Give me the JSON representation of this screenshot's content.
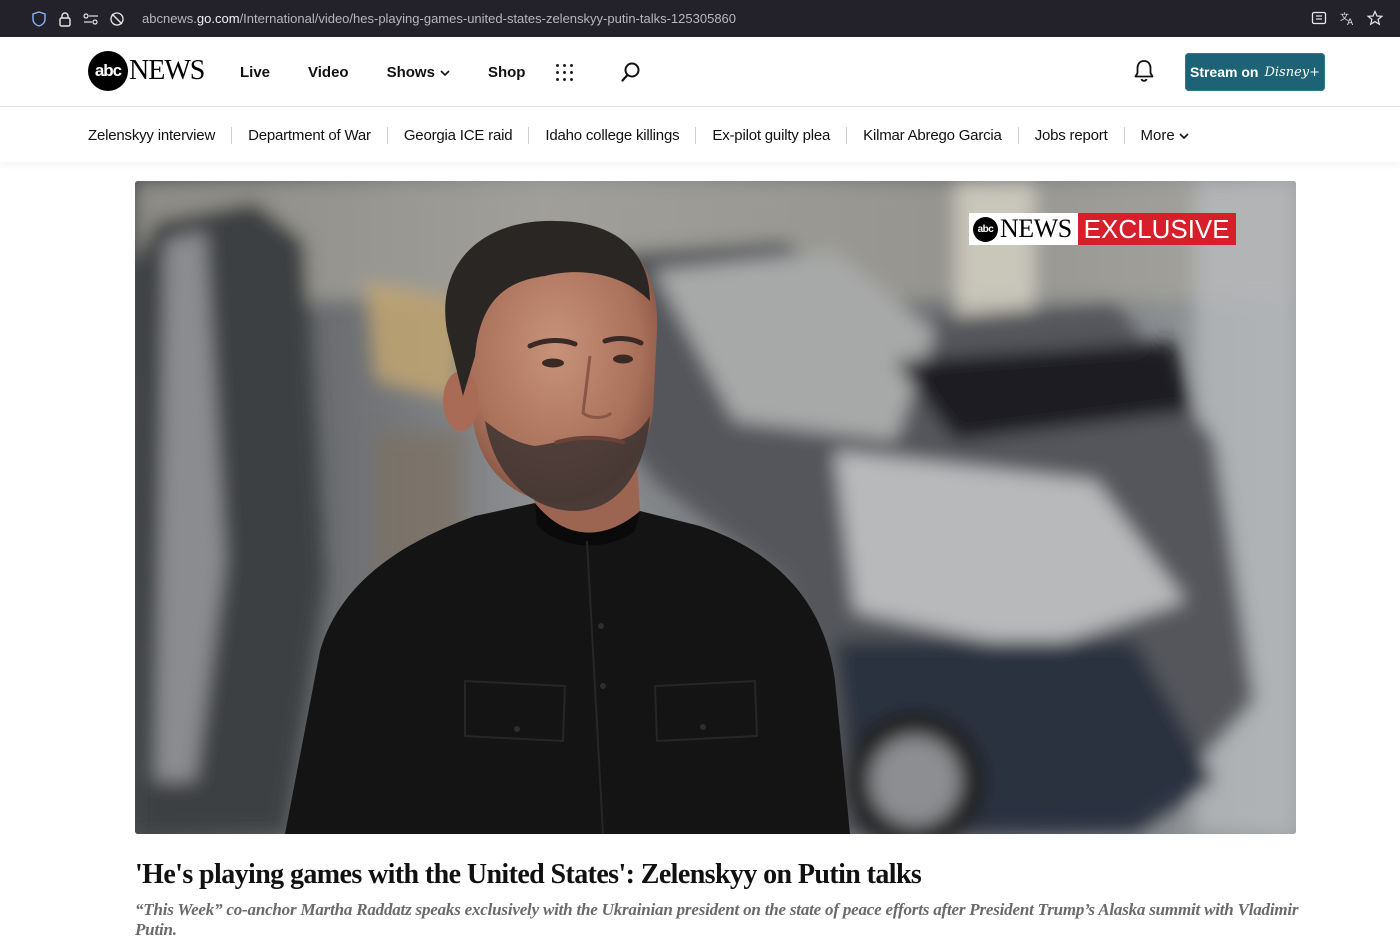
{
  "browser": {
    "url_prefix": "abcnews.",
    "url_host": "go.com",
    "url_path": "/International/video/hes-playing-games-united-states-zelenskyy-putin-talks-125305860"
  },
  "header": {
    "logo_abc": "abc",
    "logo_news": "NEWS",
    "nav": [
      {
        "label": "Live"
      },
      {
        "label": "Video"
      },
      {
        "label": "Shows"
      },
      {
        "label": "Shop"
      }
    ],
    "stream_label": "Stream on",
    "stream_brand": "Disney+"
  },
  "trending": {
    "items": [
      "Zelenskyy interview",
      "Department of War",
      "Georgia ICE raid",
      "Idaho college killings",
      "Ex-pilot guilty plea",
      "Kilmar Abrego Garcia",
      "Jobs report"
    ],
    "more_label": "More"
  },
  "video": {
    "badge_abc": "abc",
    "badge_news": "NEWS",
    "badge_exclusive": "EXCLUSIVE"
  },
  "article": {
    "headline": "'He's playing games with the United States': Zelenskyy on Putin talks",
    "dek": "“This Week” co-anchor Martha Raddatz speaks exclusively with the Ukrainian president on the state of peace efforts after President Trump’s Alaska summit with Vladimir Putin."
  },
  "colors": {
    "stream_button": "#1d6275",
    "exclusive_red": "#d71f2b",
    "urlbar_bg": "#23222b"
  }
}
